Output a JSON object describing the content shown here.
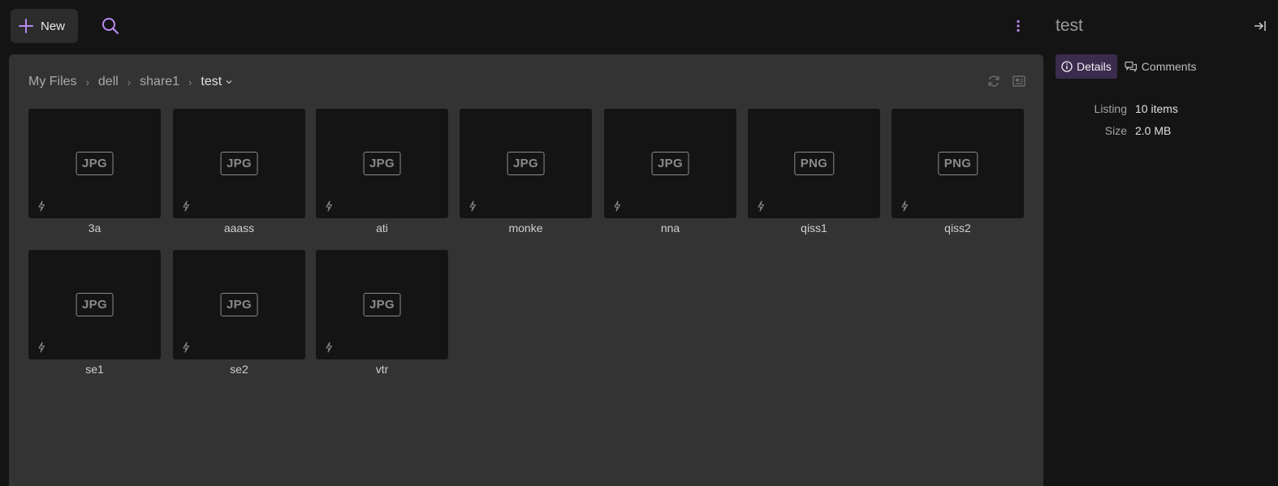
{
  "toolbar": {
    "new_label": "New",
    "search_icon": "search-icon",
    "more_icon": "more-vertical-icon",
    "accent_color": "#b98af0"
  },
  "breadcrumb": {
    "items": [
      "My Files",
      "dell",
      "share1"
    ],
    "current": "test"
  },
  "panel_icons": [
    "refresh-icon",
    "image-preview-icon"
  ],
  "files": [
    {
      "name": "3a",
      "type": "JPG"
    },
    {
      "name": "aaass",
      "type": "JPG"
    },
    {
      "name": "ati",
      "type": "JPG"
    },
    {
      "name": "monke",
      "type": "JPG"
    },
    {
      "name": "nna",
      "type": "JPG"
    },
    {
      "name": "qiss1",
      "type": "PNG"
    },
    {
      "name": "qiss2",
      "type": "PNG"
    },
    {
      "name": "se1",
      "type": "JPG"
    },
    {
      "name": "se2",
      "type": "JPG"
    },
    {
      "name": "vtr",
      "type": "JPG"
    }
  ],
  "sidebar": {
    "title": "test",
    "tabs": [
      {
        "label": "Details",
        "icon": "info-icon",
        "active": true
      },
      {
        "label": "Comments",
        "icon": "comments-icon",
        "active": false
      }
    ],
    "properties": [
      {
        "key": "Listing",
        "value": "10 items"
      },
      {
        "key": "Size",
        "value": "2.0 MB"
      }
    ],
    "active_tab_color": "#3b2b4d"
  }
}
